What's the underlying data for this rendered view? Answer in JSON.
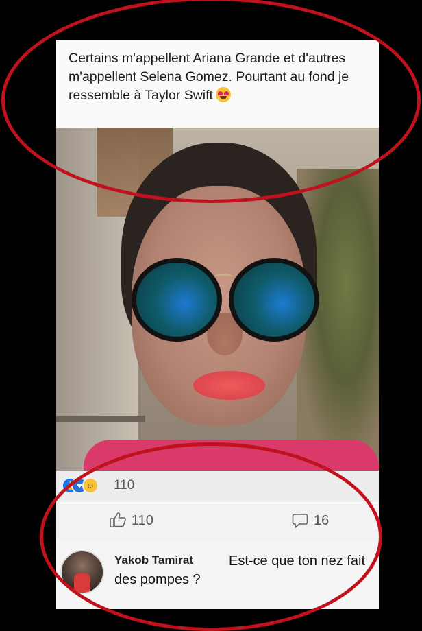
{
  "post": {
    "caption": "Certains m'appellent Ariana Grande et d'autres m'appellent Selena Gomez. Pourtant au fond je ressemble à Taylor Swift",
    "caption_emoji": "heart-eyes-emoji"
  },
  "reactions": {
    "icons": [
      "like-icon",
      "love-icon",
      "haha-icon"
    ],
    "count": "110"
  },
  "actions": {
    "like_count": "110",
    "comment_count": "16"
  },
  "comment": {
    "author": "Yakob Tamirat",
    "text": "Est-ce que ton nez fait des pompes ?"
  },
  "annotations": {
    "ring_color": "#c0121c"
  }
}
